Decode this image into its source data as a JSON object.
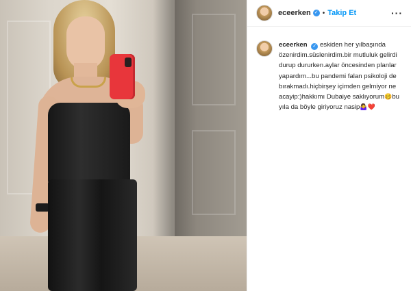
{
  "post": {
    "username": "eceerken",
    "verified_icon": "verified-badge-icon",
    "separator": "•",
    "follow_label": "Takip Et",
    "more_label": "···"
  },
  "caption": {
    "username": "eceerken",
    "text": "eskiden her yılbaşında özenirdim.süslenirdim.bir mutluluk gelirdi durup dururken.aylar öncesinden planlar yapardım...bu pandemi falan psikoloji de bırakmadı.hiçbirşey içimden gelmiyor ne acayip:)hakkımı Dubaiye saklıyorum",
    "emoji_1": "🥴",
    "text_2": "bu yıla da böyle giriyoruz nasip",
    "emoji_2": "🤷‍♀️",
    "emoji_3": "❤️"
  },
  "colors": {
    "accent": "#0095f6",
    "verified": "#3897f0",
    "phone": "#e8363b"
  }
}
